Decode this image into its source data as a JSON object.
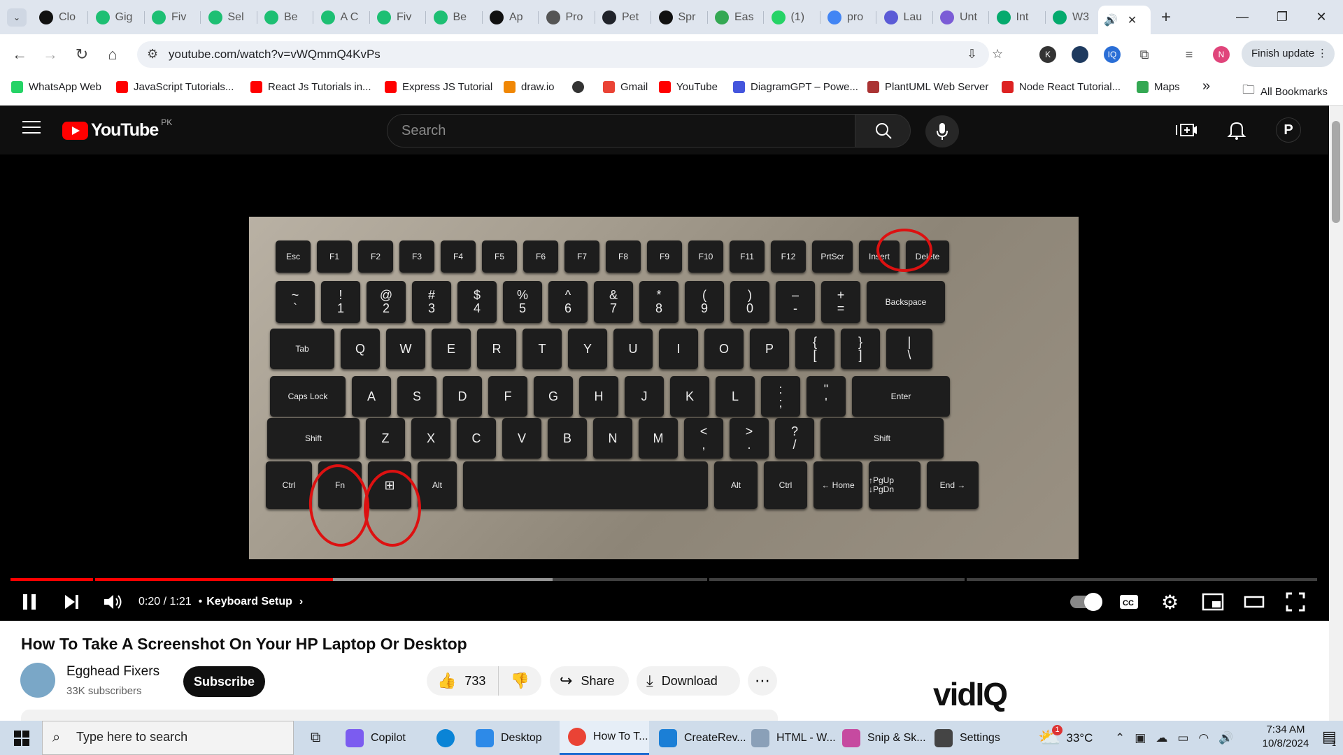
{
  "browser": {
    "tabs": [
      {
        "label": "Clo",
        "color": "#111"
      },
      {
        "label": "Gig",
        "color": "#1dbf73"
      },
      {
        "label": "Fiv",
        "color": "#1dbf73"
      },
      {
        "label": "Sel",
        "color": "#1dbf73"
      },
      {
        "label": "Be",
        "color": "#1dbf73"
      },
      {
        "label": "A C",
        "color": "#1dbf73"
      },
      {
        "label": "Fiv",
        "color": "#1dbf73"
      },
      {
        "label": "Be",
        "color": "#1dbf73"
      },
      {
        "label": "Ap",
        "color": "#111"
      },
      {
        "label": "Pro",
        "color": "#555"
      },
      {
        "label": "Pet",
        "color": "#20232a"
      },
      {
        "label": "Spr",
        "color": "#111"
      },
      {
        "label": "Eas",
        "color": "#34a853"
      },
      {
        "label": "(1)",
        "color": "#25d366"
      },
      {
        "label": "pro",
        "color": "#4285f4"
      },
      {
        "label": "Lau",
        "color": "#5b5bd6"
      },
      {
        "label": "Unt",
        "color": "#7b5cd6"
      },
      {
        "label": "Int",
        "color": "#04aa6d"
      },
      {
        "label": "W3",
        "color": "#04aa6d"
      }
    ],
    "active_tab_icon": "speaker-icon",
    "url": "youtube.com/watch?v=vWQmmQ4KvPs",
    "finish_update_label": "Finish update",
    "extensions": [
      {
        "label": "K",
        "color": "#333"
      },
      {
        "label": "",
        "color": "#1e3a5f"
      },
      {
        "label": "IQ",
        "color": "#2a6ed6"
      }
    ],
    "profile_initial": "N",
    "bookmarks": [
      {
        "label": "WhatsApp Web",
        "color": "#25d366"
      },
      {
        "label": "JavaScript Tutorials...",
        "color": "#ff0000"
      },
      {
        "label": "React Js Tutorials in...",
        "color": "#ff0000"
      },
      {
        "label": "Express JS Tutorial",
        "color": "#ff0000"
      },
      {
        "label": "draw.io",
        "color": "#f08705"
      },
      {
        "label": "",
        "color": "#333"
      },
      {
        "label": "Gmail",
        "color": "#ea4335"
      },
      {
        "label": "YouTube",
        "color": "#ff0000"
      },
      {
        "label": "DiagramGPT – Powe...",
        "color": "#4455dd"
      },
      {
        "label": "PlantUML Web Server",
        "color": "#aa3333"
      },
      {
        "label": "Node React Tutorial...",
        "color": "#dd2222"
      },
      {
        "label": "Maps",
        "color": "#34a853"
      }
    ],
    "more_bookmarks": "»",
    "all_bookmarks_label": "All Bookmarks"
  },
  "youtube": {
    "logo_text": "YouTube",
    "country_code": "PK",
    "search_placeholder": "Search",
    "avatar_initial": "P",
    "player": {
      "current_time": "0:20",
      "duration": "1:21",
      "time_display": "0:20 / 1:21",
      "chapter": "Keyboard Setup",
      "progress_fraction": 0.247,
      "buffered_fraction": 0.415,
      "chapter_breaks": [
        0.063,
        0.533,
        0.73
      ]
    },
    "video": {
      "title": "How To Take A Screenshot On Your HP Laptop Or Desktop",
      "channel": "Egghead Fixers",
      "subscribers": "33K subscribers",
      "subscribe_label": "Subscribe",
      "likes": "733",
      "share_label": "Share",
      "download_label": "Download"
    },
    "sidebar_ad": "vidIQ",
    "keyboard_rows": [
      [
        {
          "t": "Esc"
        },
        {
          "t": "F1"
        },
        {
          "t": "F2"
        },
        {
          "t": "F3"
        },
        {
          "t": "F4"
        },
        {
          "t": "F5"
        },
        {
          "t": "F6"
        },
        {
          "t": "F7"
        },
        {
          "t": "F8"
        },
        {
          "t": "F9"
        },
        {
          "t": "F10"
        },
        {
          "t": "F11"
        },
        {
          "t": "F12"
        },
        {
          "t": "PrtScr"
        },
        {
          "t": "Insert"
        },
        {
          "t": "Delete"
        }
      ],
      [
        {
          "t": "~ `"
        },
        {
          "t": "! 1"
        },
        {
          "t": "@ 2"
        },
        {
          "t": "# 3"
        },
        {
          "t": "$ 4"
        },
        {
          "t": "% 5"
        },
        {
          "t": "^ 6"
        },
        {
          "t": "& 7"
        },
        {
          "t": "* 8"
        },
        {
          "t": "( 9"
        },
        {
          "t": ") 0"
        },
        {
          "t": "– -"
        },
        {
          "t": "+ ="
        },
        {
          "t": "Backspace"
        }
      ],
      [
        {
          "t": "Tab"
        },
        {
          "t": "Q"
        },
        {
          "t": "W"
        },
        {
          "t": "E"
        },
        {
          "t": "R"
        },
        {
          "t": "T"
        },
        {
          "t": "Y"
        },
        {
          "t": "U"
        },
        {
          "t": "I"
        },
        {
          "t": "O"
        },
        {
          "t": "P"
        },
        {
          "t": "{ ["
        },
        {
          "t": "} ]"
        },
        {
          "t": "| \\"
        }
      ],
      [
        {
          "t": "Caps Lock"
        },
        {
          "t": "A"
        },
        {
          "t": "S"
        },
        {
          "t": "D"
        },
        {
          "t": "F"
        },
        {
          "t": "G"
        },
        {
          "t": "H"
        },
        {
          "t": "J"
        },
        {
          "t": "K"
        },
        {
          "t": "L"
        },
        {
          "t": ": ;"
        },
        {
          "t": "\" '"
        },
        {
          "t": "Enter"
        }
      ],
      [
        {
          "t": "Shift"
        },
        {
          "t": "Z"
        },
        {
          "t": "X"
        },
        {
          "t": "C"
        },
        {
          "t": "V"
        },
        {
          "t": "B"
        },
        {
          "t": "N"
        },
        {
          "t": "M"
        },
        {
          "t": "< ,"
        },
        {
          "t": "> ."
        },
        {
          "t": "? /"
        },
        {
          "t": "Shift"
        }
      ],
      [
        {
          "t": "Ctrl"
        },
        {
          "t": "Fn"
        },
        {
          "t": "⊞"
        },
        {
          "t": "Alt"
        },
        {
          "t": ""
        },
        {
          "t": "Alt"
        },
        {
          "t": "Ctrl"
        },
        {
          "t": "← Home"
        },
        {
          "t": "↑PgUp ↓PgDn"
        },
        {
          "t": "End →"
        }
      ]
    ]
  },
  "taskbar": {
    "search_placeholder": "Type here to search",
    "apps": [
      {
        "label": "Copilot",
        "color": "#7b5cf0"
      },
      {
        "label": "",
        "color": "#0a84d6"
      },
      {
        "label": "Desktop",
        "color": "#2d8ae8"
      },
      {
        "label": "How To T...",
        "color": "#ea4335"
      },
      {
        "label": "CreateRev...",
        "color": "#1b7fd6"
      },
      {
        "label": "HTML - W...",
        "color": "#8aa0b8"
      },
      {
        "label": "Snip & Sk...",
        "color": "#c64aa0"
      },
      {
        "label": "Settings",
        "color": "#444"
      }
    ],
    "weather": "33°C",
    "weather_badge": "1",
    "time": "7:34 AM",
    "date": "10/8/2024",
    "notification_count": "1"
  }
}
